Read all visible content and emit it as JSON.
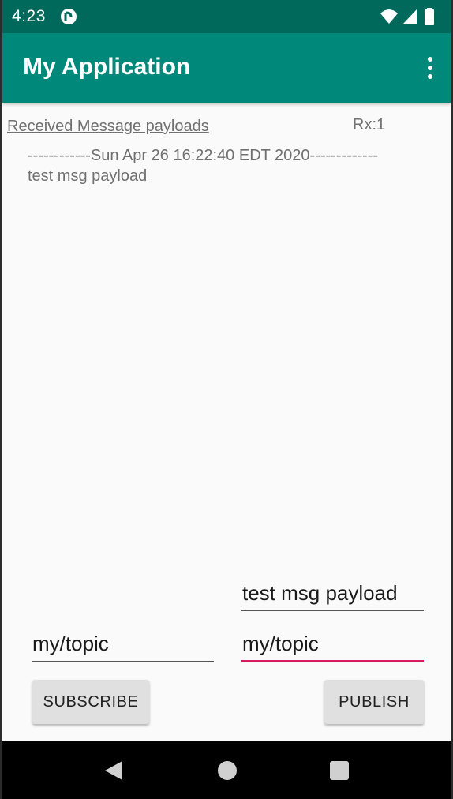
{
  "status_bar": {
    "time": "4:23",
    "icons": [
      "app-notification-icon",
      "wifi-icon",
      "cell-signal-icon",
      "battery-icon"
    ]
  },
  "app_bar": {
    "title": "My Application",
    "overflow_icon": "more-vert-icon"
  },
  "received": {
    "header": "Received Message payloads",
    "rx_count": "Rx:1",
    "messages": [
      {
        "separator": "------------Sun Apr 26 16:22:40 EDT 2020-------------",
        "payload": "test msg payload"
      }
    ]
  },
  "inputs": {
    "publish_payload": "test msg payload",
    "subscribe_topic": "my/topic",
    "publish_topic": "my/topic"
  },
  "buttons": {
    "subscribe_label": "SUBSCRIBE",
    "publish_label": "PUBLISH"
  },
  "nav_bar": {
    "icons": [
      "back-icon",
      "home-icon",
      "recents-icon"
    ]
  },
  "colors": {
    "status_bar": "#00695c",
    "app_bar": "#00897b",
    "focused_underline": "#d81b60",
    "button": "#e0e0e0"
  }
}
